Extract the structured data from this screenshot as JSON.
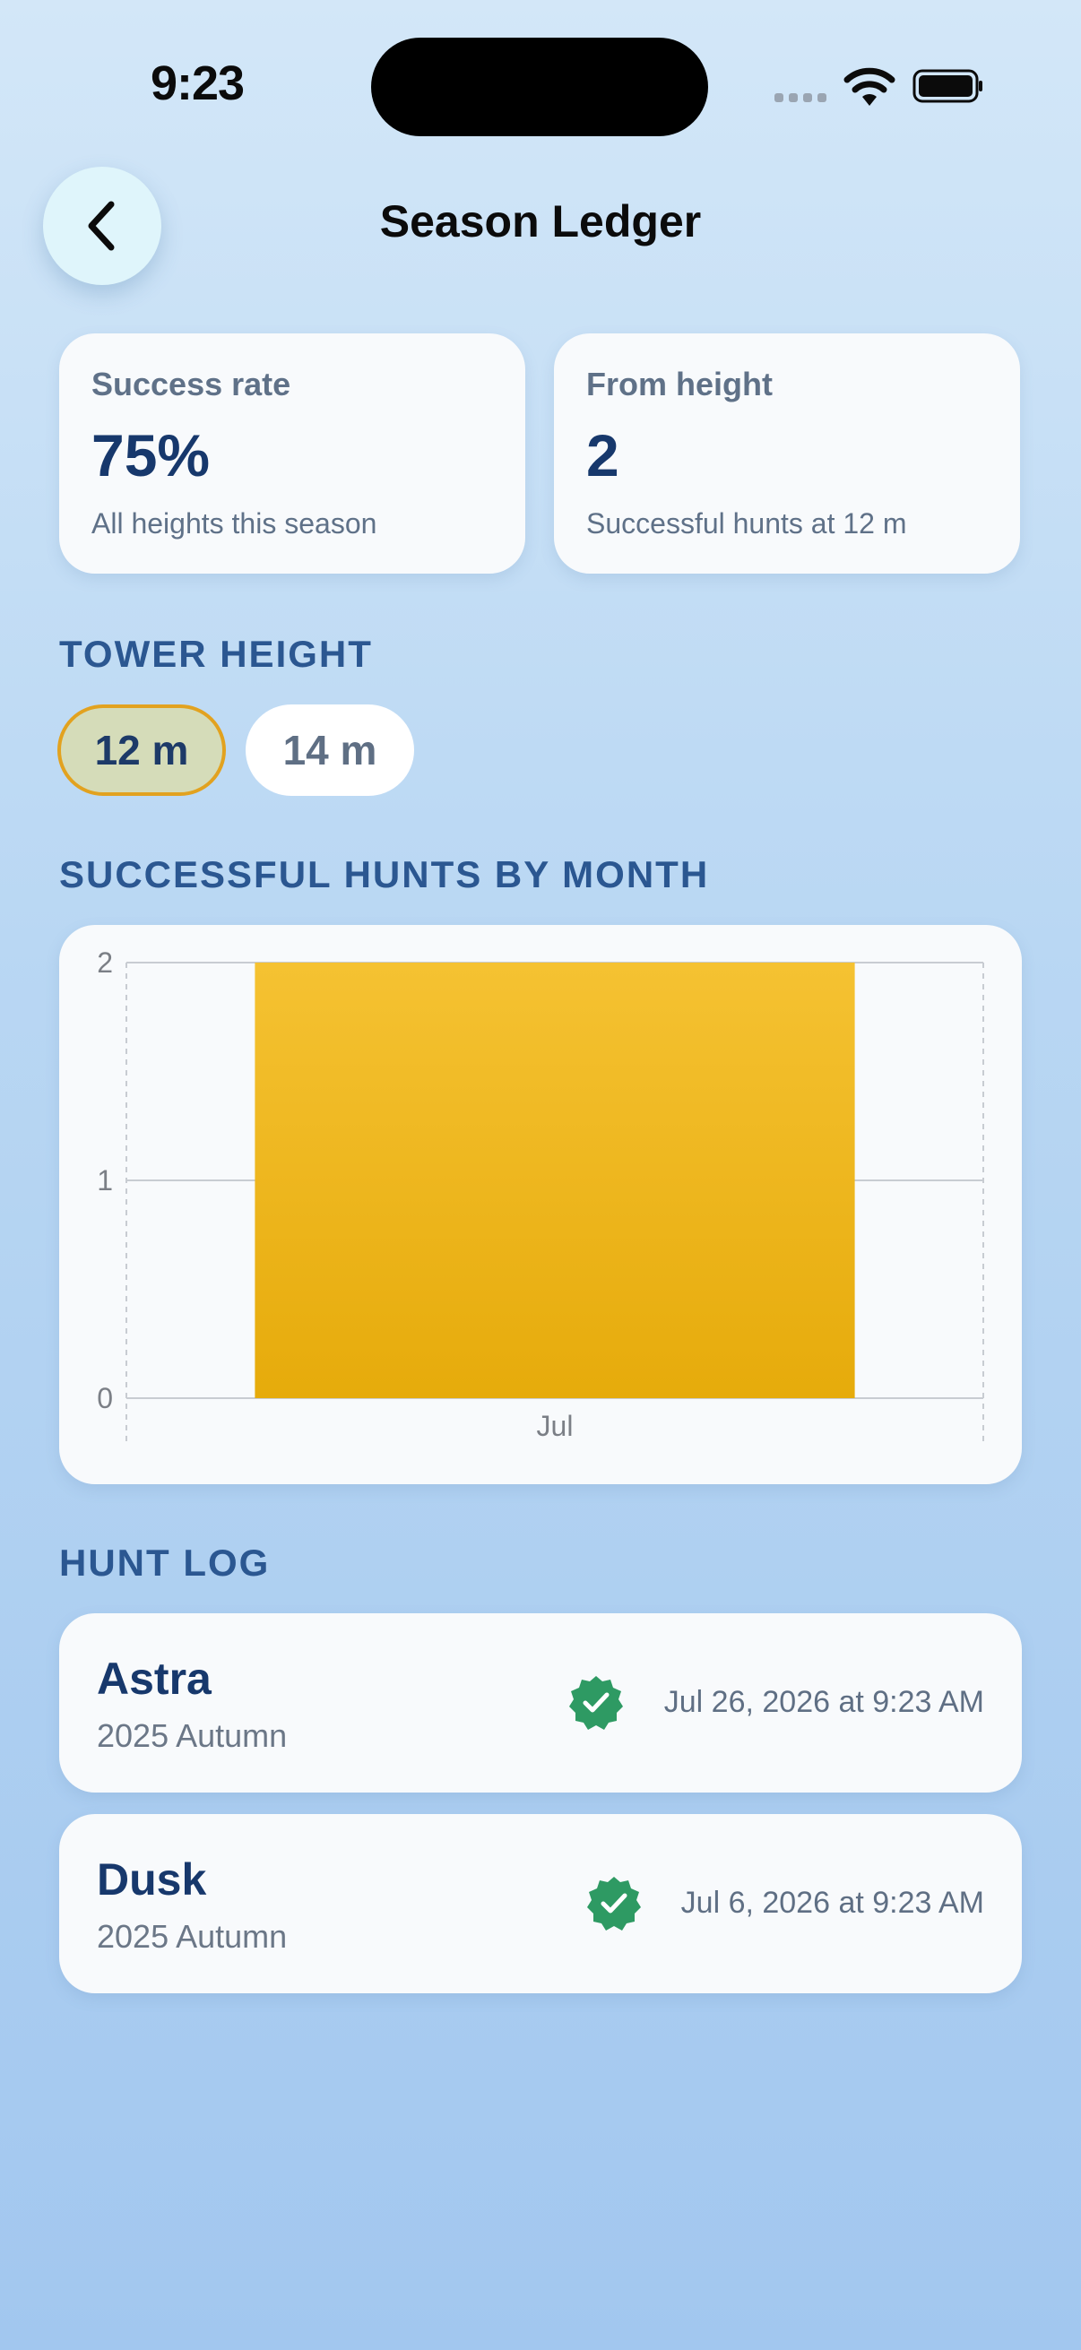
{
  "status_bar": {
    "time": "9:23"
  },
  "header": {
    "title": "Season Ledger"
  },
  "stats": [
    {
      "label": "Success rate",
      "value": "75%",
      "sub": "All heights this season"
    },
    {
      "label": "From height",
      "value": "2",
      "sub": "Successful hunts at 12 m"
    }
  ],
  "tower_height": {
    "section_title": "TOWER HEIGHT",
    "options": [
      "12 m",
      "14 m"
    ],
    "selected": "12 m"
  },
  "chart_section_title": "SUCCESSFUL HUNTS BY MONTH",
  "chart_data": {
    "type": "bar",
    "categories": [
      "Jul"
    ],
    "values": [
      2
    ],
    "ylim": [
      0,
      2
    ],
    "yticks": [
      "0",
      "1",
      "2"
    ],
    "colors": {
      "bar_top": "#f5c232",
      "bar_bottom": "#e6ab0b"
    }
  },
  "hunt_log": {
    "section_title": "HUNT LOG",
    "entries": [
      {
        "name": "Astra",
        "season": "2025 Autumn",
        "date": "Jul 26, 2026 at 9:23 AM",
        "status_icon": "verified-check-icon"
      },
      {
        "name": "Dusk",
        "season": "2025 Autumn",
        "date": "Jul 6, 2026 at 9:23 AM",
        "status_icon": "verified-check-icon"
      }
    ]
  },
  "colors": {
    "accent": "#e2a21f",
    "success": "#2e9a63",
    "heading": "#2b5791"
  }
}
